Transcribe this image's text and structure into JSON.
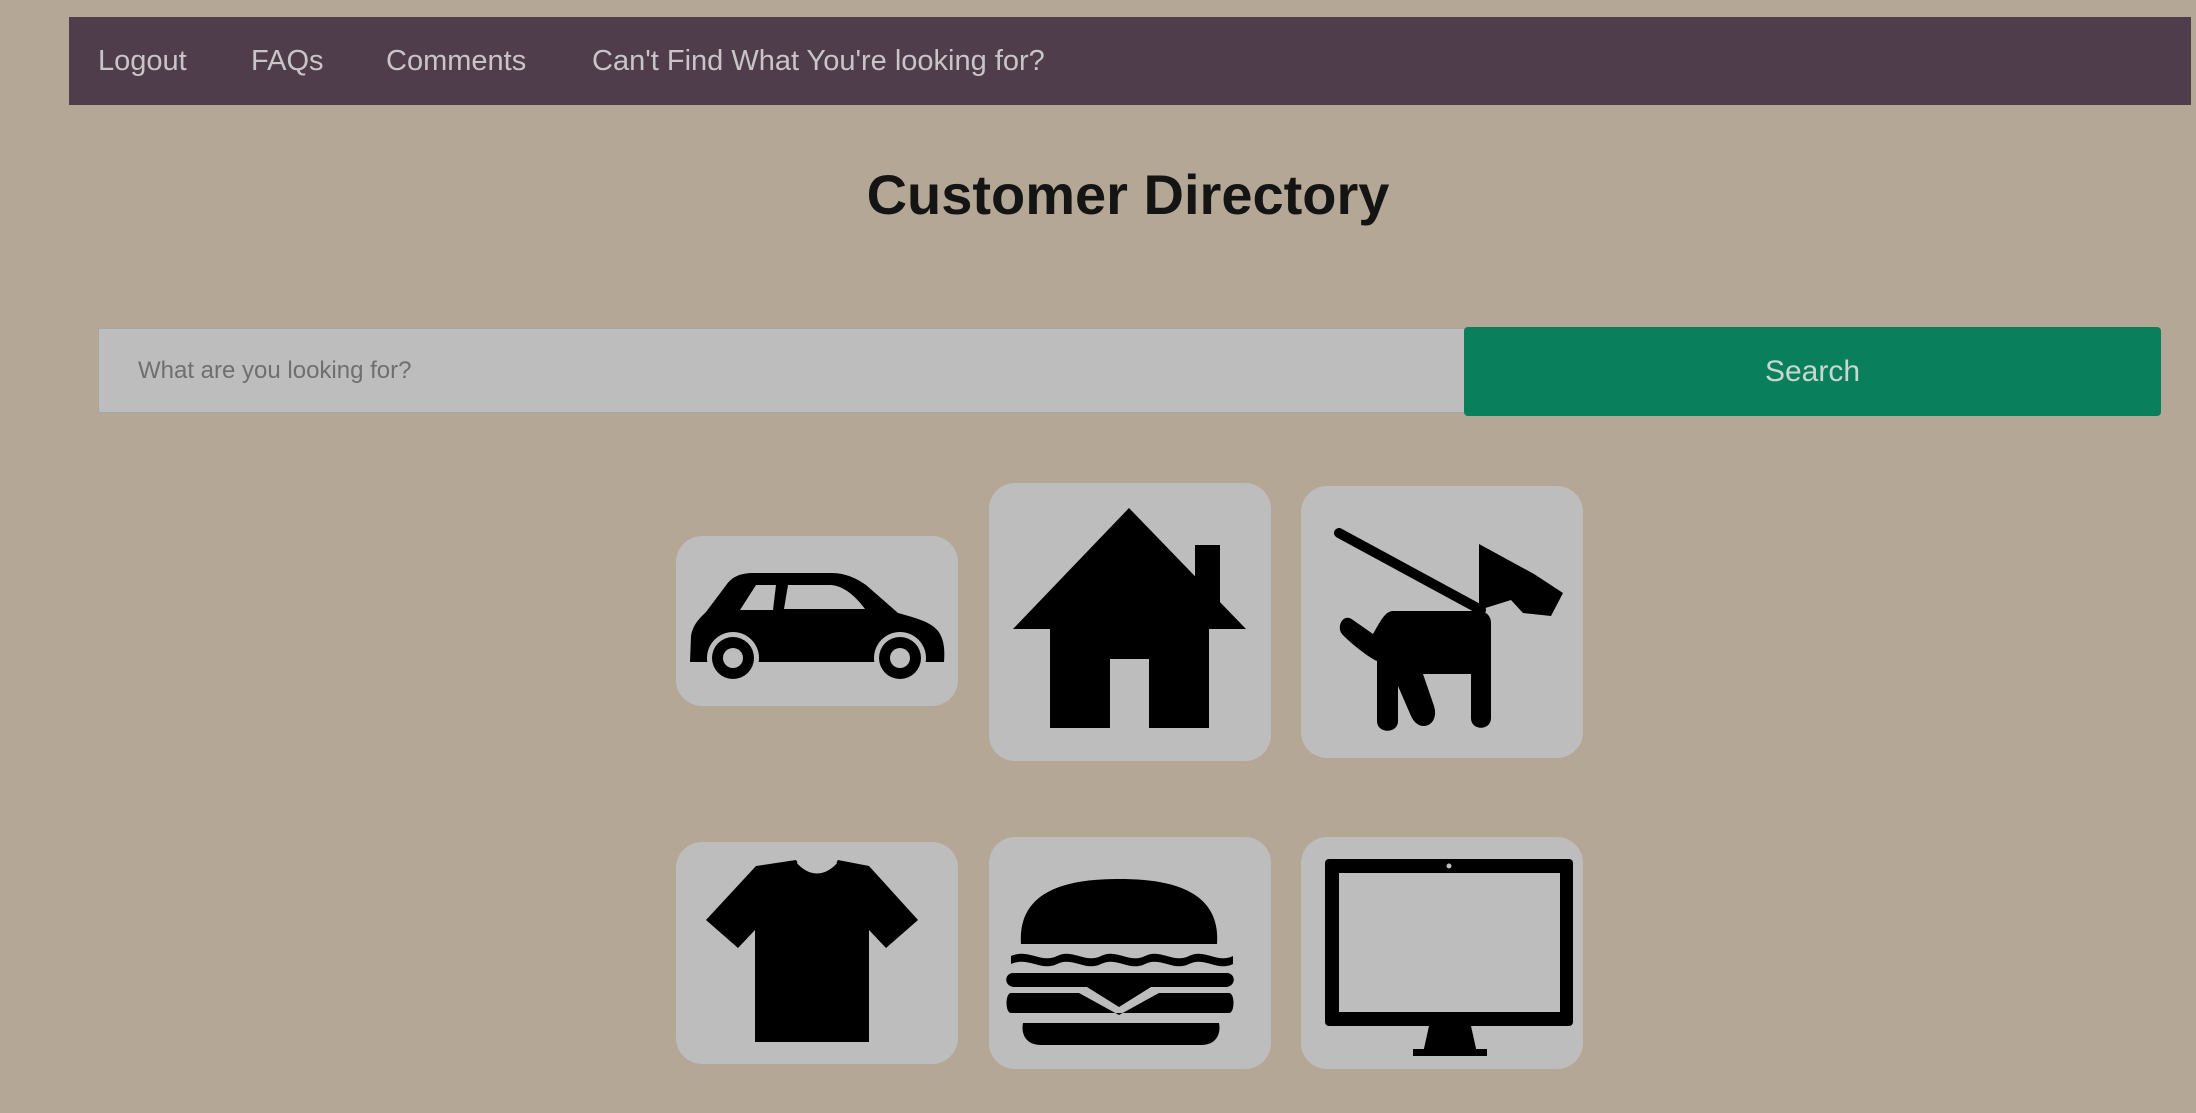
{
  "nav": {
    "items": [
      {
        "label": "Logout"
      },
      {
        "label": "FAQs"
      },
      {
        "label": "Comments"
      },
      {
        "label": "Can't Find What You're looking for?"
      }
    ]
  },
  "page": {
    "title": "Customer Directory"
  },
  "search": {
    "placeholder": "What are you looking for?",
    "button_label": "Search"
  },
  "categories": [
    {
      "icon": "car-icon"
    },
    {
      "icon": "house-icon"
    },
    {
      "icon": "dog-on-leash-icon"
    },
    {
      "icon": "t-shirt-icon"
    },
    {
      "icon": "burger-icon"
    },
    {
      "icon": "monitor-icon"
    }
  ],
  "colors": {
    "page_background": "#b4a795",
    "nav_background": "#4f3d4b",
    "accent": "#0a7f5c",
    "tile_background": "#bdbdbd",
    "icon_fill": "#000000"
  }
}
